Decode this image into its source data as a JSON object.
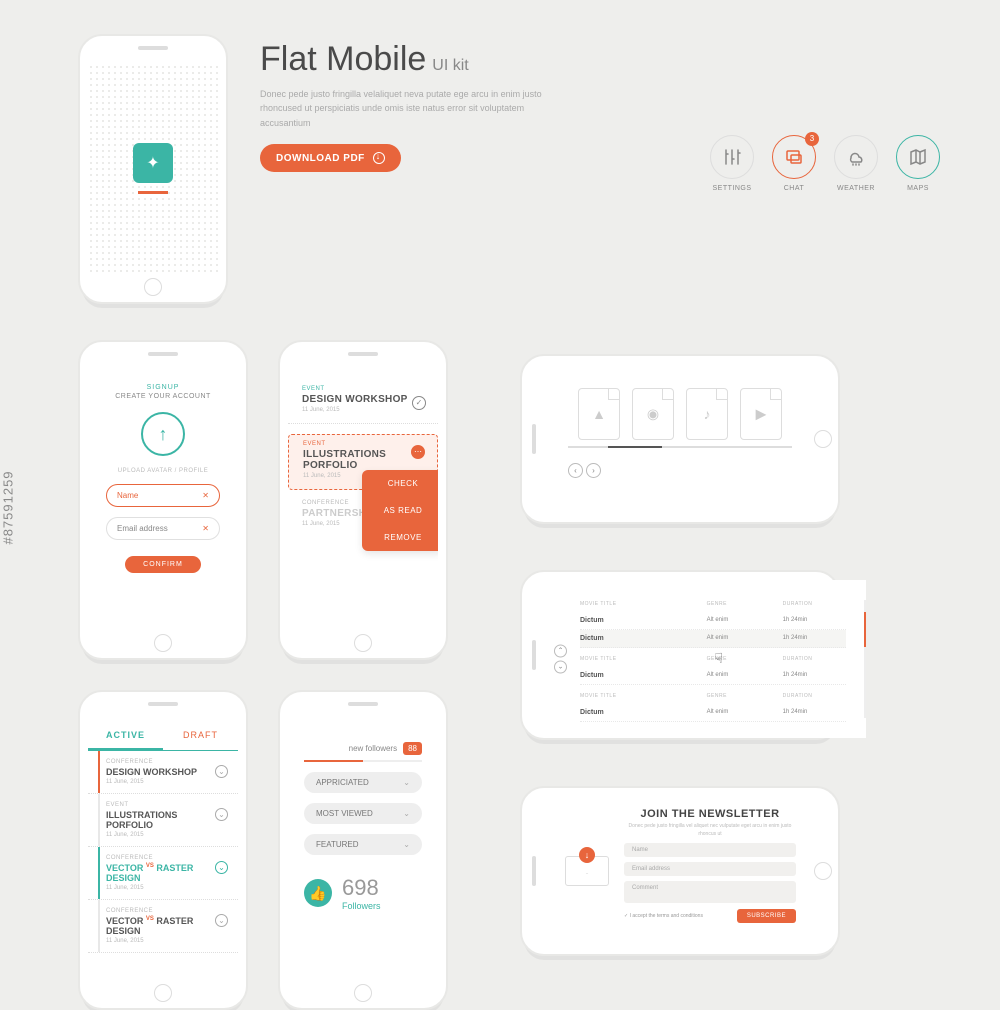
{
  "watermark": "#87591259",
  "header": {
    "title": "Flat Mobile",
    "subtitle": "UI kit",
    "lorem": "Donec pede justo fringilla velaliquet neva putate ege arcu in enim justo rhoncused ut perspiciatis unde omis iste natus error sit voluptatem accusantium",
    "download": "DOWNLOAD PDF"
  },
  "icons": {
    "settings": "SETTINGS",
    "chat": "CHAT",
    "chat_badge": "3",
    "weather": "WEATHER",
    "maps": "MAPS"
  },
  "signup": {
    "label": "SIGNUP",
    "sub": "CREATE YOUR ACCOUNT",
    "hint": "UPLOAD AVATAR / PROFILE",
    "name": "Name",
    "email": "Email address",
    "confirm": "CONFIRM"
  },
  "events": {
    "items": [
      {
        "tag": "EVENT",
        "title": "DESIGN WORKSHOP",
        "date": "11 June, 2015"
      },
      {
        "tag": "EVENT",
        "title": "ILLUSTRATIONS PORFOLIO",
        "date": "11 June, 2015"
      },
      {
        "tag": "CONFERENCE",
        "title": "PARTNERSHIP",
        "date": "11 June, 2015"
      }
    ],
    "ctx": {
      "check": "CHECK",
      "asread": "AS READ",
      "remove": "REMOVE"
    }
  },
  "tabs": {
    "active": "ACTIVE",
    "draft": "DRAFT",
    "items": [
      {
        "tag": "CONFERENCE",
        "title": "DESIGN WORKSHOP",
        "date": "11 June, 2015"
      },
      {
        "tag": "EVENT",
        "title": "ILLUSTRATIONS PORFOLIO",
        "date": "11 June, 2015"
      },
      {
        "tag": "CONFERENCE",
        "title_pre": "VECTOR ",
        "title_sup": "VS",
        "title_post": " RASTER DESIGN",
        "date": "11 June, 2015"
      },
      {
        "tag": "CONFERENCE",
        "title_pre": "VECTOR ",
        "title_sup": "VS",
        "title_post": " RASTER DESIGN",
        "date": "11 June, 2015"
      }
    ]
  },
  "followers": {
    "label": "new followers",
    "count": "88",
    "pills": [
      {
        "label": "APPRICIATED"
      },
      {
        "label": "MOST VIEWED"
      },
      {
        "label": "FEATURED"
      }
    ],
    "stat_n": "698",
    "stat_l": "Followers"
  },
  "table": {
    "h1": "MOVIE TITLE",
    "h2": "GENRE",
    "h3": "DURATION",
    "v1": "Dictum",
    "v2": "Alt enim",
    "v3": "1h 24min"
  },
  "newsletter": {
    "title": "JOIN THE NEWSLETTER",
    "lorem": "Donec pede justo fringilla vel aliquet nec vulputate eget arcu in enim justo rhoncus ut",
    "name": "Name",
    "email": "Email address",
    "comment": "Comment",
    "terms": "I accept the terms and conditions",
    "submit": "SUBSCRIBE"
  }
}
